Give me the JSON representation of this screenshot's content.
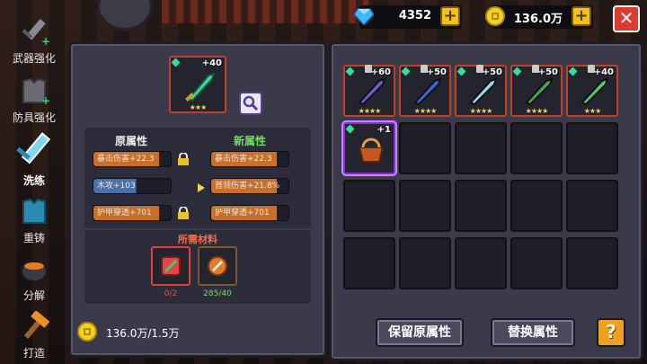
{
  "currency": {
    "gems": "4352",
    "gold": "136.0万",
    "plus_label": "+",
    "close_label": "✕"
  },
  "nav": {
    "items": [
      {
        "label": "武器强化",
        "icon": "sword-upgrade-icon"
      },
      {
        "label": "防具强化",
        "icon": "armor-upgrade-icon"
      },
      {
        "label": "洗练",
        "icon": "refine-sword-icon",
        "active": true
      },
      {
        "label": "重铸",
        "icon": "recast-armor-icon"
      },
      {
        "label": "分解",
        "icon": "decompose-cauldron-icon"
      },
      {
        "label": "打造",
        "icon": "forge-hammer-icon"
      }
    ]
  },
  "left": {
    "item_level": "+40",
    "original_title": "原属性",
    "new_title": "新属性",
    "original": [
      "暴击伤害+22.3",
      "木攻+103",
      "护甲穿透+701"
    ],
    "new": [
      "暴击伤害+22.3",
      "首领伤害+21.8%",
      "护甲穿透+701"
    ],
    "materials_title": "所需材料",
    "materials": [
      {
        "count": "0/2",
        "color": "#e04848"
      },
      {
        "count": "285/40",
        "color": "#3cd070"
      }
    ],
    "cost": "136.0万/1.5万"
  },
  "right": {
    "weapons": [
      {
        "level": "+60",
        "stars": "★★★★",
        "color": "#7a5ad8"
      },
      {
        "level": "+50",
        "stars": "★★★★",
        "color": "#3a6ad8"
      },
      {
        "level": "+50",
        "stars": "★★★★",
        "color": "#9ad8f8"
      },
      {
        "level": "+50",
        "stars": "★★★★",
        "color": "#3ab050"
      },
      {
        "level": "+40",
        "stars": "★★★",
        "color": "#5ac86a"
      }
    ],
    "selected_item_level": "+1",
    "keep_button": "保留原属性",
    "replace_button": "替换属性",
    "help_label": "?"
  }
}
